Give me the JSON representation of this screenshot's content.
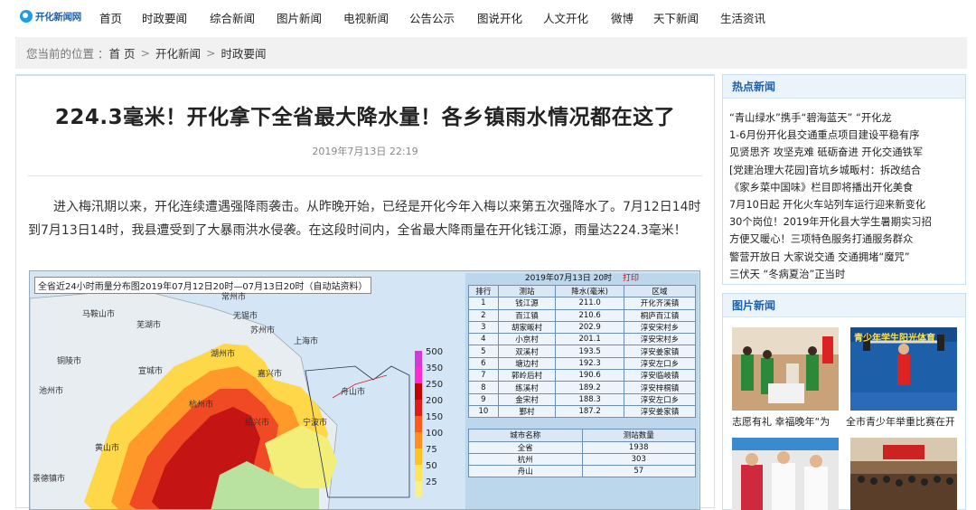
{
  "site": {
    "logo_text": "开化新闻网"
  },
  "nav": [
    "首页",
    "时政要闻",
    "综合新闻",
    "图片新闻",
    "电视新闻",
    "公告公示",
    "图说开化",
    "人文开化",
    "微博",
    "天下新闻",
    "生活资讯"
  ],
  "breadcrumb": {
    "prefix": "您当前的位置 ：",
    "items": [
      "首 页",
      "开化新闻",
      "时政要闻"
    ],
    "sep": ">"
  },
  "article": {
    "title": "224.3毫米！开化拿下全省最大降水量！各乡镇雨水情况都在这了",
    "date": "2019年7月13日 22:19",
    "body": "进入梅汛期以来，开化连续遭遇强降雨袭击。从昨晚开始，已经是开化今年入梅以来第五次强降水了。7月12日14时到7月13日14时，我县遭受到了大暴雨洪水侵袭。在这段时间内，全省最大降雨量在开化钱江源，雨量达224.3毫米！"
  },
  "figure": {
    "map_caption": "全省近24小时雨量分布图2019年07月12日20时—07月13日20时（自动站资料）",
    "cities": [
      "常州市",
      "无锡市",
      "苏州市",
      "湖州市",
      "嘉兴市",
      "上海市",
      "杭州市",
      "绍兴市",
      "宁波市",
      "舟山市",
      "池州市",
      "铜陵市",
      "黄山市",
      "景德镇市",
      "宣城市",
      "芜湖市",
      "马鞍山市"
    ],
    "legend": [
      "500",
      "350",
      "250",
      "200",
      "150",
      "100",
      "75",
      "50",
      "25"
    ],
    "legend_colors": [
      "#d23ad8",
      "#ff2ad4",
      "#c40000",
      "#e11b1b",
      "#ff5a1a",
      "#ff8f1f",
      "#ffc21f",
      "#ffe45a",
      "#f7f08a"
    ],
    "rank_table": {
      "title": "2019年07月13日 20时",
      "print_label": "打印",
      "headers": [
        "排行",
        "测站",
        "降水(毫米)",
        "区域"
      ],
      "rows": [
        [
          "1",
          "钱江源",
          "211.0",
          "开化齐溪镇"
        ],
        [
          "2",
          "百江镇",
          "210.6",
          "桐庐百江镇"
        ],
        [
          "3",
          "胡家畈村",
          "202.9",
          "淳安宋村乡"
        ],
        [
          "4",
          "小京村",
          "201.1",
          "淳安宋村乡"
        ],
        [
          "5",
          "双溪村",
          "193.5",
          "淳安姜家镇"
        ],
        [
          "6",
          "塘边村",
          "192.3",
          "淳安左口乡"
        ],
        [
          "7",
          "郭岭后村",
          "190.6",
          "淳安临岐镇"
        ],
        [
          "8",
          "练溪村",
          "189.2",
          "淳安梓桐镇"
        ],
        [
          "9",
          "金宋村",
          "188.3",
          "淳安左口乡"
        ],
        [
          "10",
          "鄞村",
          "187.2",
          "淳安姜家镇"
        ]
      ]
    },
    "count_table": {
      "headers": [
        "城市名称",
        "测站数量"
      ],
      "rows": [
        [
          "全省",
          "1938"
        ],
        [
          "杭州",
          "303"
        ],
        [
          "舟山",
          "57"
        ]
      ]
    }
  },
  "hot_news": {
    "title": "热点新闻",
    "items": [
      "“青山绿水”携手“碧海蓝天” “开化龙",
      "1-6月份开化县交通重点项目建设平稳有序",
      "见贤思齐 攻坚克难 砥砺奋进 开化交通铁军",
      "[党建治理大花园]音坑乡城畈村：拆改结合",
      "《家乡菜中国味》栏目即将播出开化美食",
      "7月10日起 开化火车站列车运行迎来新变化",
      "30个岗位！2019年开化县大学生暑期实习招",
      "方便又暖心！三项特色服务打通服务群众",
      "警营开放日 大家说交通 交通拥堵“魔咒”",
      "三伏天 “冬病夏治”正当时"
    ]
  },
  "pic_news": {
    "title": "图片新闻",
    "items": [
      {
        "caption": "志愿有礼 幸福晚年“为"
      },
      {
        "caption": "全市青少年举重比赛在开"
      },
      {
        "caption": ""
      },
      {
        "caption": ""
      }
    ],
    "banner_text": "青少年学生阳光体育"
  }
}
